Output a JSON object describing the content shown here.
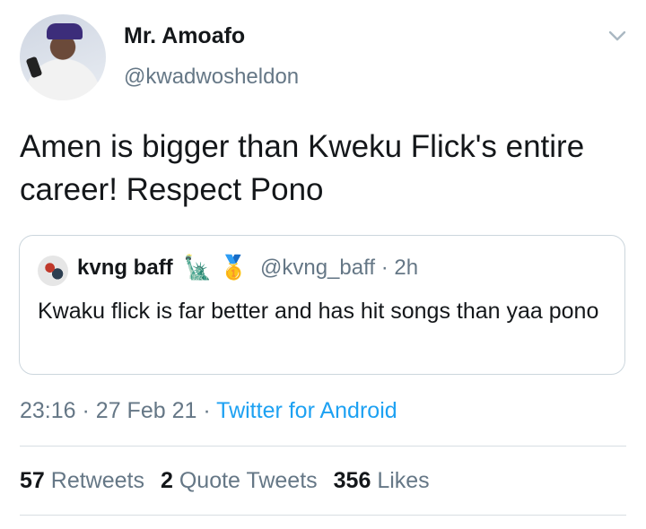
{
  "author": {
    "name": "Mr. Amoafo",
    "handle": "@kwadwosheldon"
  },
  "tweet": {
    "text": "Amen is  bigger than Kweku Flick's entire career! Respect Pono"
  },
  "quoted": {
    "name": "kvng baff",
    "emoji_1": "🗽",
    "emoji_2": "🥇",
    "handle": "@kvng_baff",
    "sep": "·",
    "time": "2h",
    "text": "Kwaku flick is far better and has hit songs than yaa pono"
  },
  "meta": {
    "time": "23:16",
    "sep1": "·",
    "date": "27 Feb 21",
    "sep2": "·",
    "source": "Twitter for Android"
  },
  "stats": {
    "retweets_count": "57",
    "retweets_label": "Retweets",
    "quotes_count": "2",
    "quotes_label": "Quote Tweets",
    "likes_count": "356",
    "likes_label": "Likes"
  },
  "icons": {
    "menu": "chevron-down-icon"
  },
  "colors": {
    "link": "#1da1f2",
    "secondary": "#657786",
    "text": "#14171a",
    "border": "#ccd6dd"
  }
}
